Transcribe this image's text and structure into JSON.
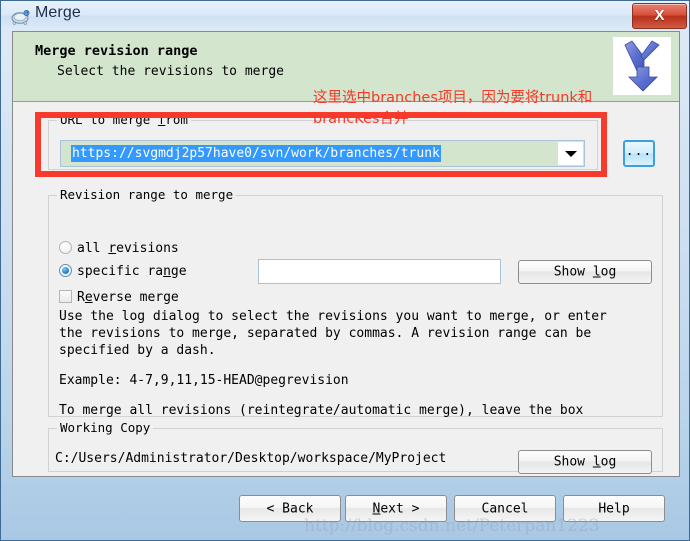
{
  "window": {
    "title": "Merge",
    "icon": "tortoisesvn-turtle-icon",
    "close_label": "X"
  },
  "banner": {
    "title": "Merge revision range",
    "subtitle": "Select the revisions to merge",
    "icon": "merge-arrow-icon"
  },
  "annotation": {
    "text": "这里选中branches项目，因为要将trunk和brancKes合并",
    "color": "#f4392b"
  },
  "highlight_box": {
    "color": "#f83a2c"
  },
  "url_group": {
    "label_pre": "URL to merge ",
    "label_accel": "f",
    "label_post": "rom",
    "value": "https://svgmdj2p57have0/svn/work/branches/trunk",
    "selected": true,
    "dropdown_icon": "chevron-down-icon",
    "browse_label": "...",
    "field_bg": "#d4e5cd",
    "selection_bg": "#3399ff"
  },
  "revision_group": {
    "label": "Revision range to merge",
    "options": [
      {
        "label_pre": "all ",
        "label_accel": "r",
        "label_post": "evisions",
        "checked": false
      },
      {
        "label_pre": "specific ra",
        "label_accel": "n",
        "label_post": "ge",
        "checked": true
      }
    ],
    "reverse_merge": {
      "label_pre": "R",
      "label_accel": "e",
      "label_post": "verse merge",
      "checked": false
    },
    "range_input_value": "",
    "show_log_label_pre": "Show ",
    "show_log_accel": "l",
    "show_log_label_post": "og",
    "help_text": "Use the log dialog to select the revisions you want to merge, or enter\nthe revisions to merge, separated by commas. A revision range can be\nspecified by a dash.",
    "example_line": "Example: 4-7,9,11,15-HEAD@pegrevision",
    "reintegrate_line": "To merge all revisions (reintegrate/automatic merge), leave the box"
  },
  "working_copy": {
    "label": "Working Copy",
    "path": "C:/Users/Administrator/Desktop/workspace/MyProject",
    "show_log_label_pre": "Show ",
    "show_log_accel": "l",
    "show_log_label_post": "og"
  },
  "footer": {
    "back": "< Back",
    "next_pre": "N",
    "next_accel": "",
    "next_post": "ext >",
    "cancel": "Cancel",
    "help": "Help"
  },
  "watermark": {
    "text": "http://blog.csdn.net/Peterpan1223"
  }
}
